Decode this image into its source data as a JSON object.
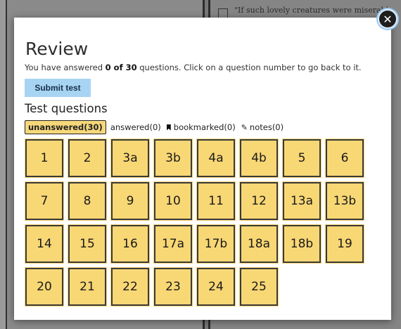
{
  "background": {
    "quote_text": "\"If such lovely creatures were miserable"
  },
  "modal": {
    "close_label": "✕",
    "title": "Review",
    "intro_prefix": "You have answered ",
    "intro_count": "0 of 30",
    "intro_suffix": " questions. Click on a question number to go back to it.",
    "submit_label": "Submit test",
    "section_heading": "Test questions",
    "filters": {
      "unanswered": "unanswered(30)",
      "answered": "answered(0)",
      "bookmarked": "bookmarked(0)",
      "notes": "notes(0)"
    },
    "questions": [
      "1",
      "2",
      "3a",
      "3b",
      "4a",
      "4b",
      "5",
      "6",
      "7",
      "8",
      "9",
      "10",
      "11",
      "12",
      "13a",
      "13b",
      "14",
      "15",
      "16",
      "17a",
      "17b",
      "18a",
      "18b",
      "19",
      "20",
      "21",
      "22",
      "23",
      "24",
      "25"
    ]
  },
  "colors": {
    "question_fill": "#f8d775",
    "submit_fill": "#a8d4f3",
    "active_filter_fill": "#f6d87a"
  }
}
